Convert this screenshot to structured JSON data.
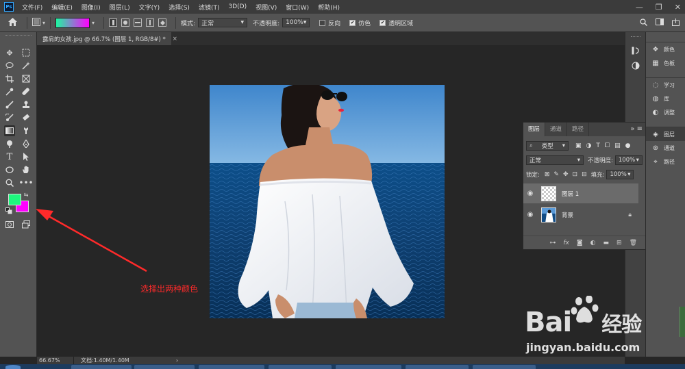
{
  "app": {
    "logo": "Ps"
  },
  "menu": [
    "文件(F)",
    "编辑(E)",
    "图像(I)",
    "图层(L)",
    "文字(Y)",
    "选择(S)",
    "滤镜(T)",
    "3D(D)",
    "视图(V)",
    "窗口(W)",
    "帮助(H)"
  ],
  "window_controls": {
    "minimize": "—",
    "restore": "❐",
    "close": "✕"
  },
  "options_bar": {
    "home_icon": "home-icon",
    "gradient_start_color": "#1df7a0",
    "gradient_end_color": "#ff00ff",
    "mode_label": "模式:",
    "mode_value": "正常",
    "opacity_label": "不透明度:",
    "opacity_value": "100%",
    "reverse_label": "反向",
    "reverse_checked": false,
    "dither_label": "仿色",
    "dither_checked": true,
    "transparency_label": "透明区域",
    "transparency_checked": true
  },
  "document_tab": {
    "title": "露肩的女孩.jpg @ 66.7% (图层 1, RGB/8#) *",
    "close": "×"
  },
  "colors": {
    "foreground": "#1df77d",
    "background": "#ff00ff"
  },
  "annotation": {
    "text": "选择出两种颜色",
    "color": "#ff2a2a"
  },
  "status_bar": {
    "zoom": "66.67%",
    "doc_info": "文档:1.40M/1.40M",
    "arrow": "›"
  },
  "right_dock": {
    "group1": [
      {
        "icon": "palette-icon",
        "label": "颜色"
      },
      {
        "icon": "grid-icon",
        "label": "色板"
      }
    ],
    "group2": [
      {
        "icon": "bulb-icon",
        "label": "学习"
      },
      {
        "icon": "library-icon",
        "label": "库"
      },
      {
        "icon": "adjust-icon",
        "label": "调整"
      }
    ],
    "group3": [
      {
        "icon": "layers-icon",
        "label": "图层"
      },
      {
        "icon": "channels-icon",
        "label": "通道"
      },
      {
        "icon": "paths-icon",
        "label": "路径"
      }
    ]
  },
  "layers_panel": {
    "tabs": [
      "图层",
      "通道",
      "路径"
    ],
    "filter_label": "类型",
    "blend_mode": "正常",
    "opacity_label": "不透明度:",
    "opacity_value": "100%",
    "lock_label": "锁定:",
    "fill_label": "填充:",
    "fill_value": "100%",
    "layers": [
      {
        "name": "图层 1",
        "selected": true
      },
      {
        "name": "背景",
        "selected": false,
        "locked": true
      }
    ],
    "footer_fx": "fx"
  },
  "watermark": {
    "brand": "Bai",
    "brand_suffix": "经验",
    "url": "jingyan.baidu.com"
  }
}
